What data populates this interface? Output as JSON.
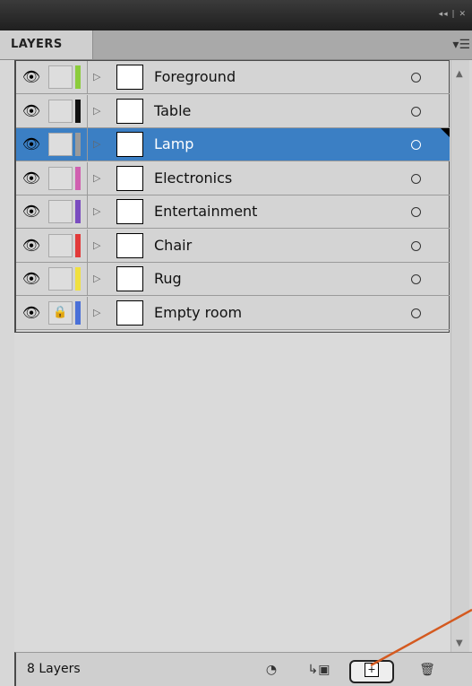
{
  "window": {
    "controls": "◂◂ | ✕"
  },
  "tabs": [
    {
      "label": "LAYERS"
    }
  ],
  "panel_menu_icon": "panel-menu-icon",
  "colors": {
    "selection": "#3b7fc4",
    "layer_colors": [
      "#8ccc3c",
      "#111111",
      "#9a9a9a",
      "#d060b0",
      "#7a4cc0",
      "#e23a3a",
      "#f0e040",
      "#4a70d8"
    ],
    "annotation_arrow": "#d45a20"
  },
  "layers": [
    {
      "name": "Foreground",
      "color": "#8ccc3c",
      "locked": false,
      "selected": false,
      "thumb_icon": "foreground-thumb-icon"
    },
    {
      "name": "Table",
      "color": "#111111",
      "locked": false,
      "selected": false,
      "thumb_icon": "table-thumb-icon"
    },
    {
      "name": "Lamp",
      "color": "#9a9a9a",
      "locked": false,
      "selected": true,
      "thumb_icon": "lamp-thumb-icon"
    },
    {
      "name": "Electronics",
      "color": "#d060b0",
      "locked": false,
      "selected": false,
      "thumb_icon": "electronics-thumb-icon"
    },
    {
      "name": "Entertainment",
      "color": "#7a4cc0",
      "locked": false,
      "selected": false,
      "thumb_icon": "entertainment-thumb-icon"
    },
    {
      "name": "Chair",
      "color": "#e23a3a",
      "locked": false,
      "selected": false,
      "thumb_icon": "chair-thumb-icon"
    },
    {
      "name": "Rug",
      "color": "#f0e040",
      "locked": false,
      "selected": false,
      "thumb_icon": "rug-thumb-icon"
    },
    {
      "name": "Empty room",
      "color": "#4a70d8",
      "locked": true,
      "selected": false,
      "thumb_icon": "empty-room-thumb-icon"
    }
  ],
  "footer": {
    "count_label": "8 Layers",
    "buttons": [
      "make-clipping-mask-icon",
      "create-sublayer-icon",
      "create-new-layer-icon",
      "delete-layer-icon"
    ]
  }
}
